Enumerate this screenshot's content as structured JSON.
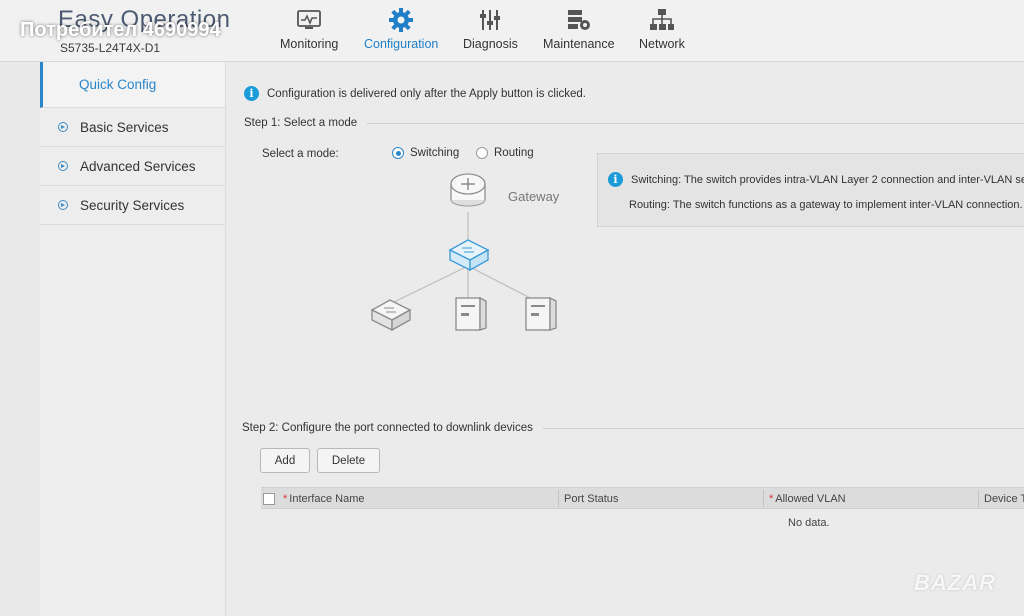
{
  "watermark": {
    "top_text": "Потребител 4690994",
    "bottom_text": "BAZAR"
  },
  "header": {
    "brand": "Easy Operation",
    "device_model": "S5735-L24T4X-D1",
    "nav": [
      {
        "label": "Monitoring",
        "icon": "monitor-icon",
        "active": false
      },
      {
        "label": "Configuration",
        "icon": "gear-icon",
        "active": true
      },
      {
        "label": "Diagnosis",
        "icon": "sliders-icon",
        "active": false
      },
      {
        "label": "Maintenance",
        "icon": "server-gear-icon",
        "active": false
      },
      {
        "label": "Network",
        "icon": "network-topology-icon",
        "active": false
      }
    ]
  },
  "sidebar": {
    "items": [
      {
        "label": "Quick Config",
        "active": true
      },
      {
        "label": "Basic Services",
        "active": false
      },
      {
        "label": "Advanced Services",
        "active": false
      },
      {
        "label": "Security Services",
        "active": false
      }
    ]
  },
  "main": {
    "notice": "Configuration is delivered only after the Apply button is clicked.",
    "step1": {
      "title": "Step 1: Select a mode",
      "mode_label": "Select a mode:",
      "options": [
        {
          "label": "Switching",
          "checked": true
        },
        {
          "label": "Routing",
          "checked": false
        }
      ],
      "info_switching": "Switching: The switch provides intra-VLAN Layer 2 connection and inter-VLAN se",
      "info_routing": "Routing: The switch functions as a gateway to implement inter-VLAN connection.",
      "gateway_label": "Gateway"
    },
    "step2": {
      "title": "Step 2: Configure the port connected to downlink devices",
      "add_label": "Add",
      "delete_label": "Delete",
      "table": {
        "headers": [
          {
            "label": "Interface Name",
            "required": true
          },
          {
            "label": "Port Status",
            "required": false
          },
          {
            "label": "Allowed VLAN",
            "required": true
          },
          {
            "label": "Device T",
            "required": false
          }
        ],
        "empty_text": "No data."
      }
    }
  },
  "colors": {
    "accent": "#2a86c9",
    "info": "#1b9cd8",
    "required": "#dd3333"
  }
}
